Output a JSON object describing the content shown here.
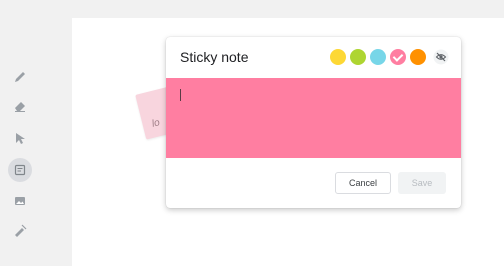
{
  "toolbar": {
    "tools": [
      {
        "name": "pen",
        "icon": "pen-icon"
      },
      {
        "name": "eraser",
        "icon": "eraser-icon"
      },
      {
        "name": "select",
        "icon": "pointer-icon"
      },
      {
        "name": "sticky-note",
        "icon": "sticky-note-icon",
        "active": true
      },
      {
        "name": "image",
        "icon": "image-icon"
      },
      {
        "name": "laser",
        "icon": "laser-icon"
      }
    ]
  },
  "background_note": {
    "text": "lo"
  },
  "dialog": {
    "title": "Sticky note",
    "colors": [
      {
        "name": "yellow",
        "hex": "#fdd835",
        "selected": false
      },
      {
        "name": "green",
        "hex": "#aed531",
        "selected": false
      },
      {
        "name": "cyan",
        "hex": "#77d6e8",
        "selected": false
      },
      {
        "name": "pink",
        "hex": "#ff7ea1",
        "selected": true
      },
      {
        "name": "orange",
        "hex": "#ff9100",
        "selected": false
      }
    ],
    "hide_icon": "visibility-off-icon",
    "note_text": "",
    "note_color": "#ff7ea1",
    "cancel_label": "Cancel",
    "save_label": "Save"
  }
}
